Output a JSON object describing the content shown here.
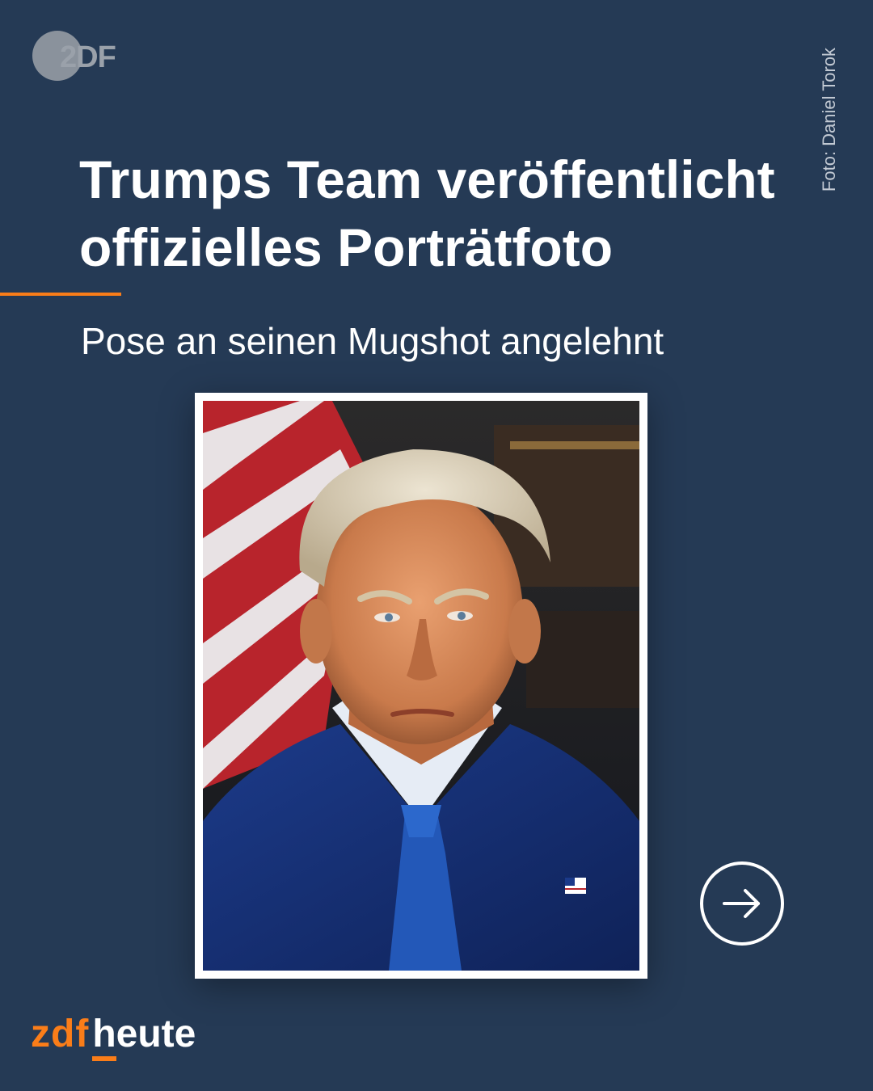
{
  "brand": {
    "top_logo_text": "2DF",
    "bottom_logo_zdf": "zdf",
    "bottom_logo_heute": "heute",
    "accent_color": "#fa7d19",
    "background_color": "#253a55"
  },
  "credit": "Foto: Daniel Torok",
  "headline": {
    "line1": "Trumps Team veröffentlicht",
    "line2": "offizielles Porträtfoto"
  },
  "subline": "Pose an seinen Mugshot angelehnt",
  "photo": {
    "subject": "official-portrait-photo"
  },
  "next_button": {
    "icon": "arrow-right-circle-icon"
  }
}
